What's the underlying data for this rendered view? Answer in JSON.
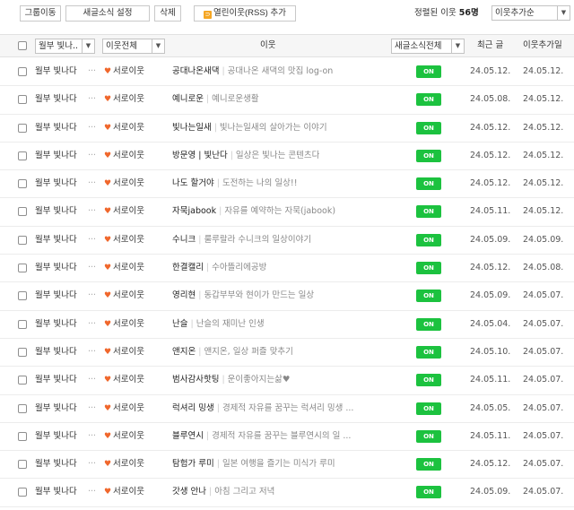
{
  "toolbar": {
    "group_move": "그룹이동",
    "news_settings": "새글소식 설정",
    "delete": "삭제",
    "rss_add": "열린이웃(RSS) 추가",
    "sort_prefix": "정렬된 이웃",
    "sort_count": "56명",
    "sort_select": "이웃추가순"
  },
  "header": {
    "group_filter": "월부 빛나..",
    "type_filter": "이웃전체",
    "neighbor_col": "이웃",
    "news_filter": "새글소식전체",
    "recent_col": "최근 글",
    "added_col": "이웃추가일"
  },
  "icons": {
    "rss": "rss-icon",
    "heart": "heart-icon",
    "dropdown": "chevron-down-icon"
  },
  "colors": {
    "on_badge": "#1cc23f",
    "heart": "#f0672c",
    "rss": "#f5a623"
  },
  "rows": [
    {
      "group": "월부 빛나다",
      "type": "서로이웃",
      "nick": "공대나온새댁",
      "blog": "공대나온 새댁의 맛집 log-on",
      "news": "ON",
      "recent": "24.05.12.",
      "added": "24.05.12."
    },
    {
      "group": "월부 빛나다",
      "type": "서로이웃",
      "nick": "예니로운",
      "blog": "예니로운생활",
      "news": "ON",
      "recent": "24.05.08.",
      "added": "24.05.12."
    },
    {
      "group": "월부 빛나다",
      "type": "서로이웃",
      "nick": "빛나는일새",
      "blog": "빛나는일새의 살아가는 이야기",
      "news": "ON",
      "recent": "24.05.12.",
      "added": "24.05.12."
    },
    {
      "group": "월부 빛나다",
      "type": "서로이웃",
      "nick": "방문영 | 빛난다",
      "blog": "일상은 빛나는 콘텐츠다",
      "news": "ON",
      "recent": "24.05.12.",
      "added": "24.05.12."
    },
    {
      "group": "월부 빛나다",
      "type": "서로이웃",
      "nick": "나도 할거야",
      "blog": "도전하는 나의 일상!!",
      "news": "ON",
      "recent": "24.05.12.",
      "added": "24.05.12."
    },
    {
      "group": "월부 빛나다",
      "type": "서로이웃",
      "nick": "자묵jabook",
      "blog": "자유를 예약하는 자묵(jabook)",
      "news": "ON",
      "recent": "24.05.11.",
      "added": "24.05.12."
    },
    {
      "group": "월부 빛나다",
      "type": "서로이웃",
      "nick": "수니크",
      "blog": "룰루랄라 수니크의 일상이야기",
      "news": "ON",
      "recent": "24.05.09.",
      "added": "24.05.09."
    },
    {
      "group": "월부 빛나다",
      "type": "서로이웃",
      "nick": "한결캘리",
      "blog": "수아뜰리에공방",
      "news": "ON",
      "recent": "24.05.12.",
      "added": "24.05.08."
    },
    {
      "group": "월부 빛나다",
      "type": "서로이웃",
      "nick": "영리현",
      "blog": "동갑부부와 현이가 만드는 일상",
      "news": "ON",
      "recent": "24.05.09.",
      "added": "24.05.07."
    },
    {
      "group": "월부 빛나다",
      "type": "서로이웃",
      "nick": "난슬",
      "blog": "난슬의 재미난 인생",
      "news": "ON",
      "recent": "24.05.04.",
      "added": "24.05.07."
    },
    {
      "group": "월부 빛나다",
      "type": "서로이웃",
      "nick": "앤지온",
      "blog": "앤지온, 일상 퍼즐 맞추기",
      "news": "ON",
      "recent": "24.05.10.",
      "added": "24.05.07."
    },
    {
      "group": "월부 빛나다",
      "type": "서로이웃",
      "nick": "범사감사핫팅",
      "blog": "운이좋아지는삶♥",
      "news": "ON",
      "recent": "24.05.11.",
      "added": "24.05.07."
    },
    {
      "group": "월부 빛나다",
      "type": "서로이웃",
      "nick": "럭셔리 밍생",
      "blog": "경제적 자유를 꿈꾸는 럭셔리 밍생 ...",
      "news": "ON",
      "recent": "24.05.05.",
      "added": "24.05.07."
    },
    {
      "group": "월부 빛나다",
      "type": "서로이웃",
      "nick": "블루연시",
      "blog": "경제적 자유를 꿈꾸는 블루연시의 일 ...",
      "news": "ON",
      "recent": "24.05.11.",
      "added": "24.05.07."
    },
    {
      "group": "월부 빛나다",
      "type": "서로이웃",
      "nick": "탐험가 루미",
      "blog": "일본 여행을 즐기는 미식가 루미",
      "news": "ON",
      "recent": "24.05.12.",
      "added": "24.05.07."
    },
    {
      "group": "월부 빛나다",
      "type": "서로이웃",
      "nick": "갓생 안나",
      "blog": "아침 그리고 저녁",
      "news": "ON",
      "recent": "24.05.09.",
      "added": "24.05.07."
    }
  ]
}
